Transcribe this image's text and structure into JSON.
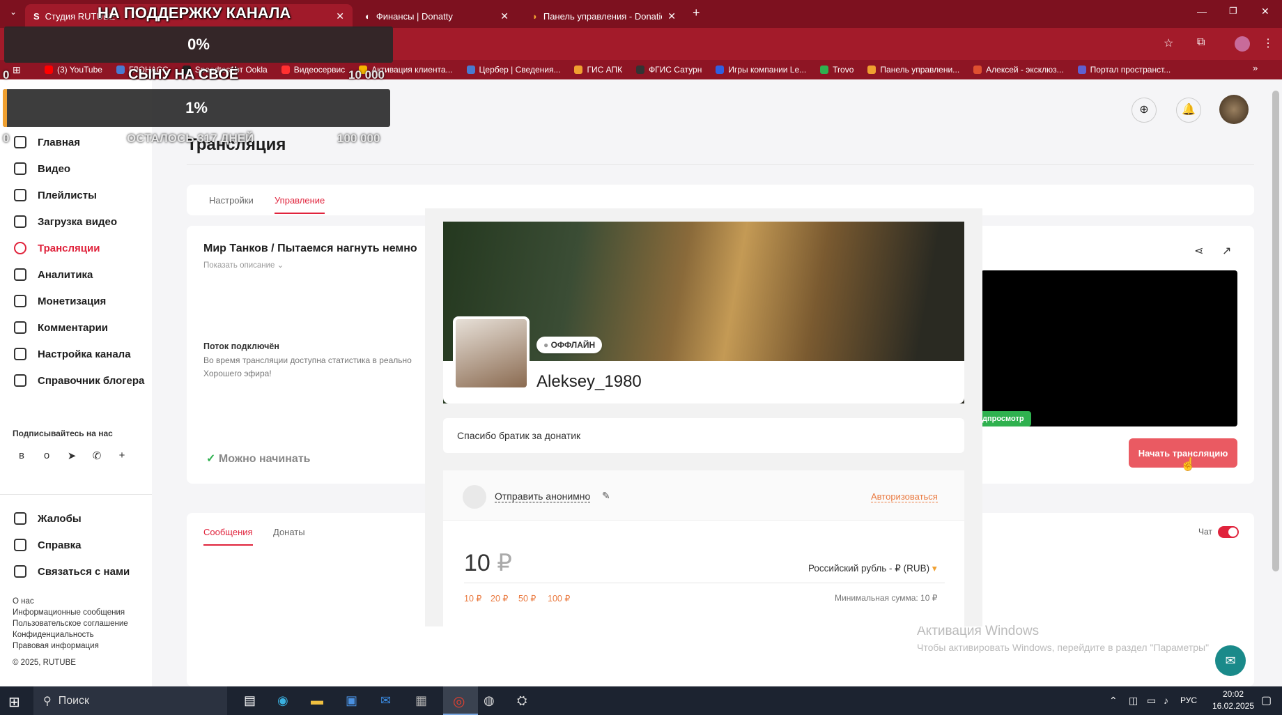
{
  "browser": {
    "tabs": [
      {
        "label": "Студия RUTUBE"
      },
      {
        "label": "Финансы | Donatty"
      },
      {
        "label": "Панель управления - Donatio"
      }
    ],
    "bookmarks": [
      "(3) YouTube",
      "ГЛОНАСС",
      "Speedtest от Ookla",
      "Видеосервис",
      "Активация клиента...",
      "Цербер | Сведения...",
      "ГИС АПК",
      "ФГИС Сатурн",
      "Игры компании Le...",
      "Trovo",
      "Панель управлени...",
      "Алексей - эксклюз...",
      "Портал пространст..."
    ]
  },
  "overlays": {
    "goal1_title": "НА ПОДДЕРЖКУ КАНАЛА",
    "goal1_percent": "0%",
    "goal1_progress": 0,
    "goal1_min": "0",
    "goal1_max": "10 000",
    "goal2_title": "СЫНУ НА СВОЁ",
    "goal2_percent": "1%",
    "goal2_progress": 0.01,
    "goal2_min": "0",
    "goal2_max": "100 000",
    "goal2_days": "ОСТАЛОСЬ 317 ДНЕЙ"
  },
  "sidebar": {
    "items": [
      {
        "label": "Главная"
      },
      {
        "label": "Видео"
      },
      {
        "label": "Плейлисты"
      },
      {
        "label": "Загрузка видео"
      },
      {
        "label": "Трансляции"
      },
      {
        "label": "Аналитика"
      },
      {
        "label": "Монетизация"
      },
      {
        "label": "Комментарии"
      },
      {
        "label": "Настройка канала"
      },
      {
        "label": "Справочник блогера"
      }
    ],
    "subscribe_label": "Подписывайтесь на нас",
    "bottom_items": [
      {
        "label": "Жалобы"
      },
      {
        "label": "Справка"
      },
      {
        "label": "Связаться с нами"
      }
    ],
    "footer_links": [
      "О нас",
      "Информационные сообщения",
      "Пользовательское соглашение",
      "Конфиденциальность",
      "Правовая информация"
    ],
    "copyright": "© 2025, RUTUBE"
  },
  "main": {
    "title": "Трансляция",
    "tabs": [
      "Настройки",
      "Управление"
    ],
    "stream_title": "Мир Танков / Пытаемся нагнуть немно",
    "show_description": "Показать описание",
    "stream_status_title": "Поток подключён",
    "stream_status_text1": "Во время трансляции доступна статистика в реально",
    "stream_status_text2": "Хорошего эфира!",
    "ready_label": "Можно начинать",
    "preview_badge": "дпросмотр",
    "start_button": "Начать трансляцию",
    "bottom_tabs": [
      "Сообщения",
      "Донаты"
    ],
    "chat_label": "Чат"
  },
  "donation": {
    "status": "ОФФЛАЙН",
    "username": "Aleksey_1980",
    "message": "Спасибо братик за донатик",
    "send_anon": "Отправить анонимно",
    "authorize": "Авторизоваться",
    "amount": "10",
    "currency_symbol": "₽",
    "currency_select": "Российский рубль - ₽ (RUB)",
    "quick_amounts": [
      "10 ₽",
      "20 ₽",
      "50 ₽",
      "100 ₽"
    ],
    "min_sum": "Минимальная сумма: 10 ₽"
  },
  "windows": {
    "activation_title": "Активация Windows",
    "activation_text": "Чтобы активировать Windows, перейдите в раздел \"Параметры\"",
    "search_placeholder": "Поиск",
    "lang": "РУС",
    "time": "20:02",
    "date": "16.02.2025"
  },
  "colors": {
    "accent": "#e0233c",
    "browser": "#a31b2a",
    "start_button": "#ea5a62",
    "badge_green": "#2fb14f"
  }
}
